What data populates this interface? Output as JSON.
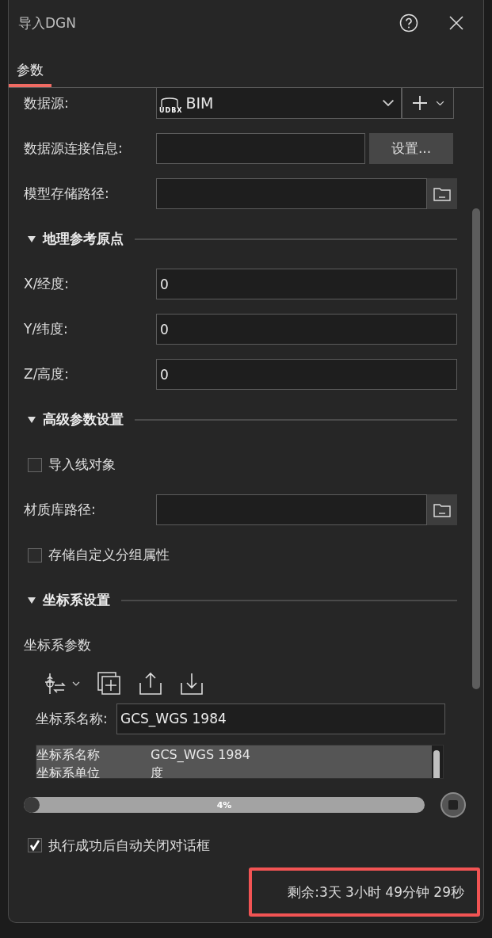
{
  "window": {
    "title": "导入DGN"
  },
  "tabs": [
    {
      "label": "参数",
      "selected": true
    }
  ],
  "rows": [
    {
      "kind": "combo",
      "label": "数据源:",
      "value": "BIM",
      "icon_text": "UDBX"
    },
    {
      "kind": "setup",
      "label": "数据源连接信息:",
      "button": "设置..."
    },
    {
      "kind": "path",
      "label": "模型存储路径:"
    },
    {
      "kind": "section",
      "title": "地理参考原点",
      "expanded": true
    },
    {
      "kind": "input",
      "label": "X/经度:",
      "value": "0"
    },
    {
      "kind": "input",
      "label": "Y/纬度:",
      "value": "0"
    },
    {
      "kind": "input",
      "label": "Z/高度:",
      "value": "0"
    },
    {
      "kind": "section",
      "title": "高级参数设置",
      "expanded": true
    },
    {
      "kind": "checkbox",
      "label": "导入线对象",
      "checked": false
    },
    {
      "kind": "path",
      "label": "材质库路径:"
    },
    {
      "kind": "checkbox",
      "label": "存储自定义分组属性",
      "checked": false
    },
    {
      "kind": "section",
      "title": "坐标系设置",
      "expanded": true
    },
    {
      "kind": "subheading",
      "label": "坐标系参数"
    },
    {
      "kind": "toolbar"
    },
    {
      "kind": "name",
      "label": "坐标系名称:",
      "value": "GCS_WGS 1984"
    },
    {
      "kind": "table",
      "items": [
        {
          "name": "坐标系名称",
          "value": "GCS_WGS 1984"
        },
        {
          "name": "坐标系单位",
          "value": "度"
        }
      ]
    }
  ],
  "progress": {
    "level": 0.04,
    "label": "4%"
  },
  "auto_close": {
    "label": "执行成功后自动关闭对话框",
    "checked": true
  },
  "remaining": {
    "text": "剩余:3天 3小时 49分钟 29秒",
    "highlighted": true
  }
}
